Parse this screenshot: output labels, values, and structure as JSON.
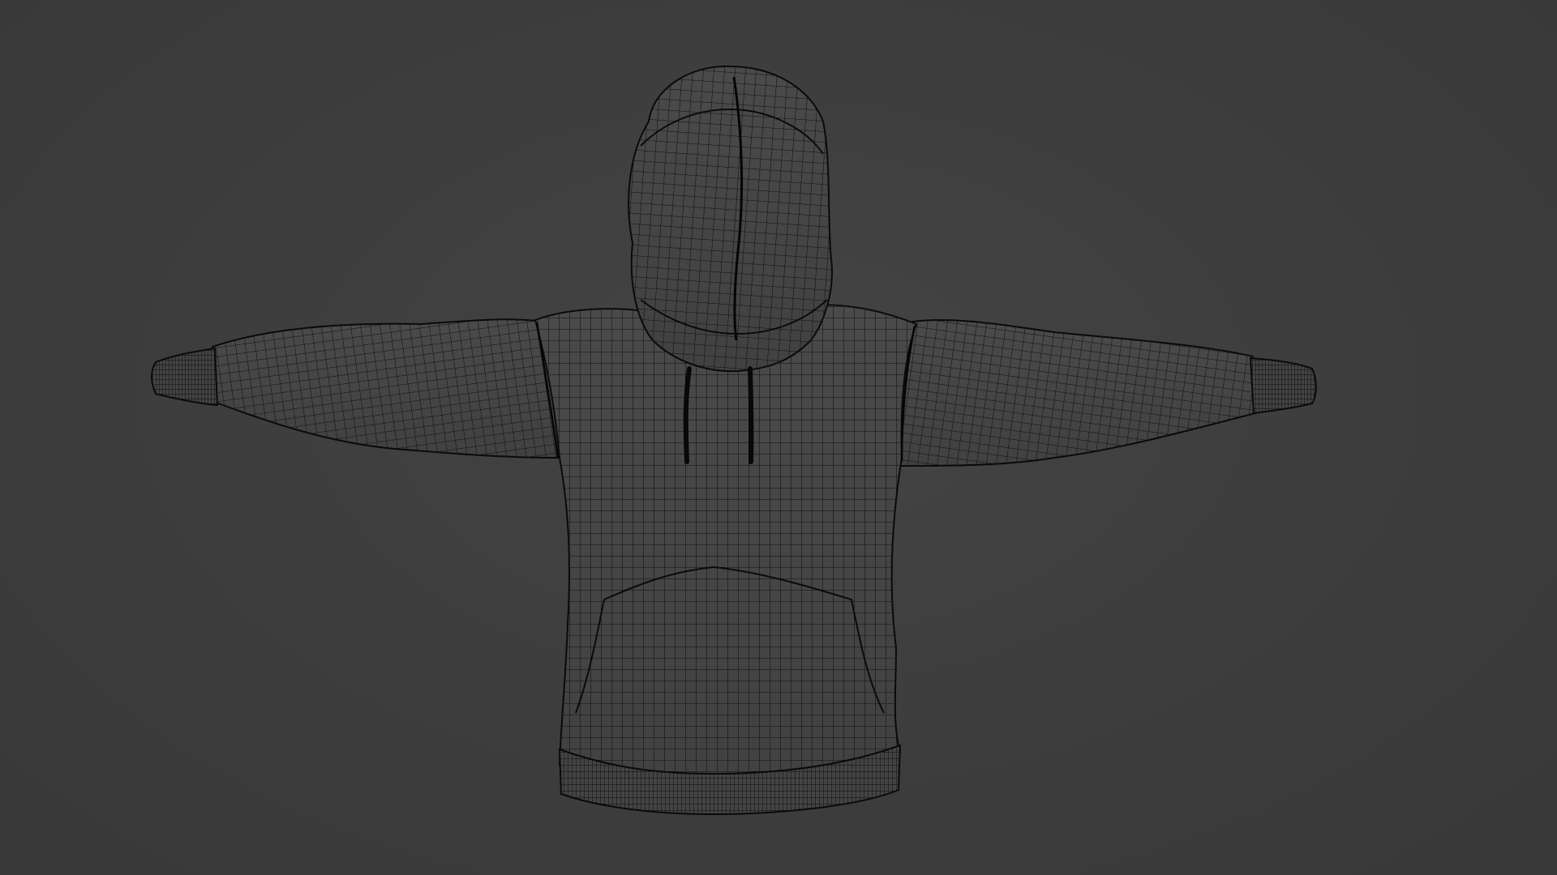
{
  "viewport": {
    "background_color": "#3d3d3d",
    "display_mode": "wireframe"
  },
  "model": {
    "subject": "hoodie",
    "wire_color": "#0a0a0a",
    "fill_color": "#474747",
    "pose": "t-pose"
  }
}
